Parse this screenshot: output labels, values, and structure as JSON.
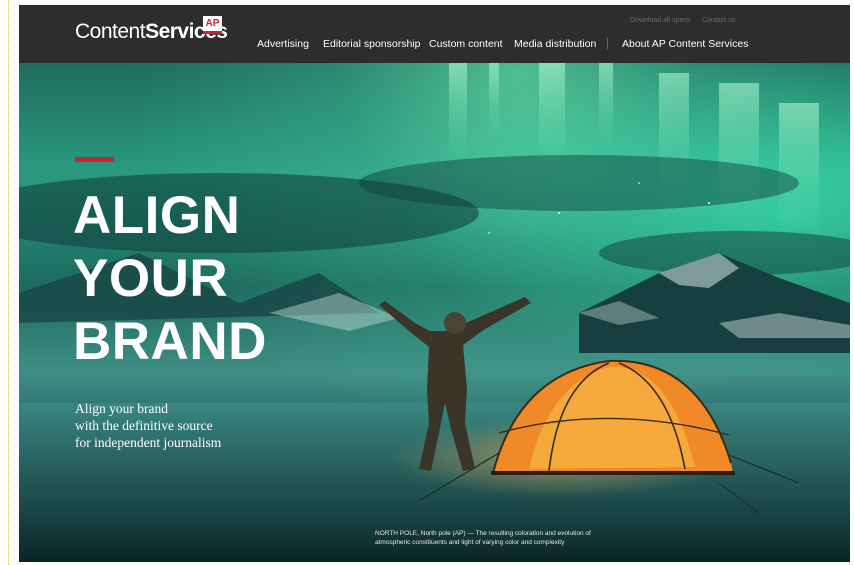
{
  "brand": {
    "logo_word1": "Content",
    "logo_word2": "Services",
    "badge": "AP"
  },
  "utility_nav": [
    "Download all specs",
    "Contact us"
  ],
  "main_nav": [
    {
      "label": "Advertising"
    },
    {
      "label": "Editorial sponsorship"
    },
    {
      "label": "Custom content"
    },
    {
      "label": "Media distribution"
    },
    {
      "label": "About AP Content Services"
    }
  ],
  "hero": {
    "headline": [
      "ALIGN",
      "YOUR",
      "BRAND"
    ],
    "subtext": [
      "Align your brand",
      "with the definitive source",
      "for independent journalism"
    ],
    "caption": [
      "NORTH POLE, North pole (AP) — The resulting coloration and evolution of",
      "atmospheric constituents and light of varying color and complexity"
    ]
  },
  "colors": {
    "header_bg": "#2d2d2d",
    "accent_red": "#d0202e",
    "aurora_green": "#2a9a80",
    "tent_orange": "#f08a28"
  }
}
